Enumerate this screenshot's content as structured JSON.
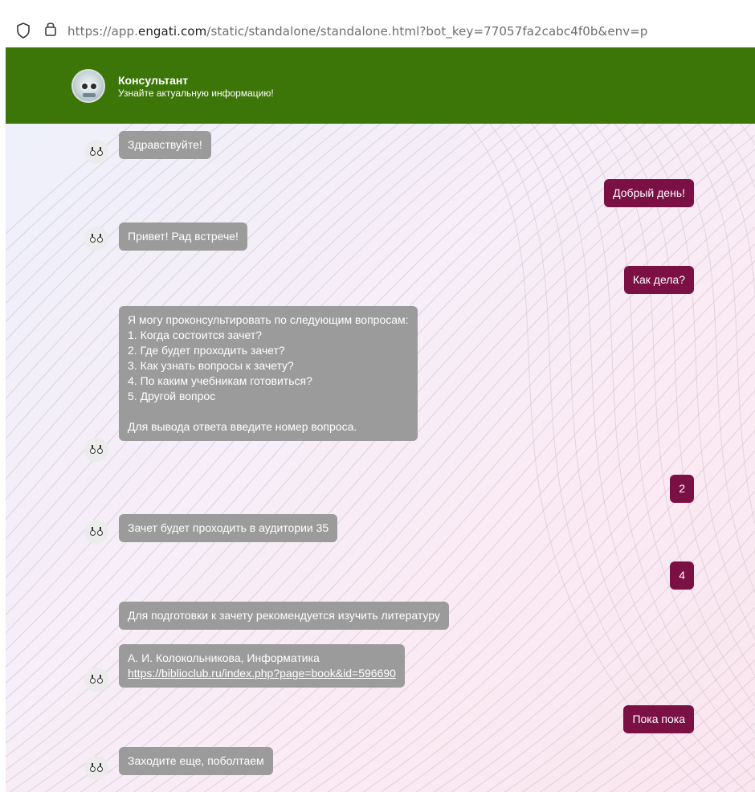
{
  "browser": {
    "url_prefix": "https://app.",
    "url_host": "engati.com",
    "url_rest": "/static/standalone/standalone.html?bot_key=77057fa2cabc4f0b&env=p"
  },
  "header": {
    "title": "Консультант",
    "subtitle": "Узнайте актуальную информацию!"
  },
  "colors": {
    "header_bg": "#3d7608",
    "bot_bubble": "#9b9b9b",
    "user_bubble": "#7b1045"
  },
  "messages": [
    {
      "from": "bot",
      "text": "Здравствуйте!"
    },
    {
      "from": "user",
      "text": "Добрый день!"
    },
    {
      "from": "bot",
      "text": "Привет! Рад встрече!"
    },
    {
      "from": "user",
      "text": "Как дела?"
    },
    {
      "from": "bot",
      "text": "Я могу проконсультировать по следующим вопросам:\n1. Когда состоится зачет?\n2. Где будет проходить зачет?\n3. Как узнать вопросы к зачету?\n4. По каким учебникам готовиться?\n5. Другой вопрос\n\nДля вывода ответа введите номер вопроса."
    },
    {
      "from": "user",
      "text": "2"
    },
    {
      "from": "bot",
      "text": "Зачет будет проходить в аудитории 35"
    },
    {
      "from": "user",
      "text": "4"
    },
    {
      "from": "bot",
      "text": "Для подготовки к зачету рекомендуется изучить литературу"
    },
    {
      "from": "bot",
      "text": "А. И. Колокольникова, Информатика",
      "link": "https://biblioclub.ru/index.php?page=book&id=596690"
    },
    {
      "from": "user",
      "text": "Пока пока"
    },
    {
      "from": "bot",
      "text": "Заходите еще, поболтаем"
    }
  ]
}
